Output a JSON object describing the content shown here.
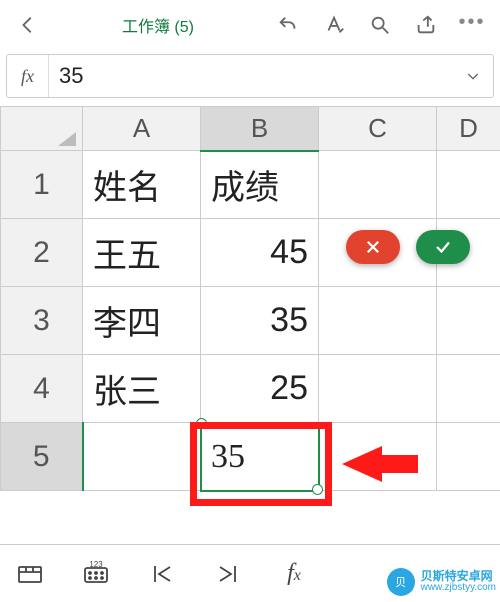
{
  "header": {
    "title": "工作簿 (5)"
  },
  "formula_bar": {
    "fx_label": "fx",
    "value": "35"
  },
  "columns": [
    "A",
    "B",
    "C",
    "D"
  ],
  "selected_column_index": 1,
  "selected_row_index": 4,
  "rows": [
    {
      "n": "1",
      "A": "姓名",
      "B": "成绩",
      "B_align": "txt"
    },
    {
      "n": "2",
      "A": "王五",
      "B": "45",
      "B_align": "num"
    },
    {
      "n": "3",
      "A": "李四",
      "B": "35",
      "B_align": "num"
    },
    {
      "n": "4",
      "A": "张三",
      "B": "25",
      "B_align": "num"
    },
    {
      "n": "5",
      "A": "",
      "B": "35",
      "B_align": "txt",
      "active": true
    }
  ],
  "confirm_pills": {
    "cancel_icon": "x",
    "confirm_icon": "check"
  },
  "bottom_icons": [
    "sheet-tabs",
    "keyboard-123",
    "go-first",
    "go-last",
    "fx-function"
  ],
  "watermark": {
    "brand_cn": "贝斯特安卓网",
    "brand_url": "www.zjbstyy.com",
    "badge": "贝"
  },
  "chart_data": {
    "type": "table",
    "columns": [
      "姓名",
      "成绩"
    ],
    "rows": [
      [
        "王五",
        45
      ],
      [
        "李四",
        35
      ],
      [
        "张三",
        25
      ]
    ],
    "active_cell_value": 35,
    "active_cell_address": "B5"
  }
}
